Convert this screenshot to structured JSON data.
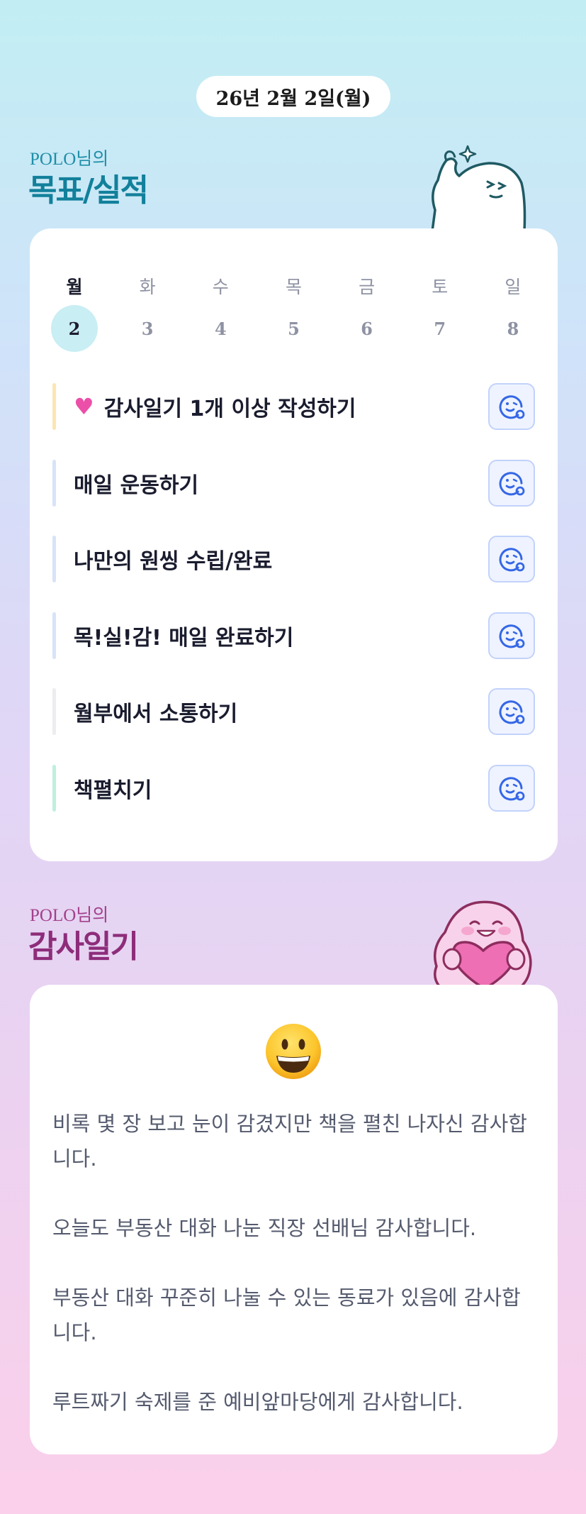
{
  "header": {
    "date": "26년 2월 2일(월)"
  },
  "goals_section": {
    "owner": "POLO님의",
    "title": "목표/실적"
  },
  "week": {
    "days": [
      "월",
      "화",
      "수",
      "목",
      "금",
      "토",
      "일"
    ],
    "dates": [
      "2",
      "3",
      "4",
      "5",
      "6",
      "7",
      "8"
    ],
    "active_index": 0
  },
  "goals": [
    {
      "label": "감사일기 1개 이상 작성하기",
      "icon": "heart-icon",
      "bar_color": "#fde5b3"
    },
    {
      "label": "매일 운동하기",
      "bar_color": "#d8e3f7"
    },
    {
      "label": "나만의 원씽 수립/완료",
      "bar_color": "#d8e3f7"
    },
    {
      "label": "목!실!감! 매일 완료하기",
      "bar_color": "#d8e3f7"
    },
    {
      "label": "월부에서 소통하기",
      "bar_color": "#ececf1"
    },
    {
      "label": "책펼치기",
      "bar_color": "#bff0dd"
    }
  ],
  "thanks_section": {
    "owner": "POLO님의",
    "title": "감사일기"
  },
  "thanks": {
    "emoji": "smiley-face-icon",
    "entries": [
      "비록 몇 장 보고 눈이 감겼지만 책을 펼친 나자신 감사합니다.",
      "오늘도 부동산 대화 나눈 직장 선배님 감사합니다.",
      "부동산 대화 꾸준히 나눌 수 있는 동료가 있음에 감사합니다.",
      "루트짜기 숙제를 준 예비앞마당에게 감사합니다."
    ]
  },
  "colors": {
    "goal_title": "#12809b",
    "thanks_title": "#8d2d7a",
    "react_button_bg": "#eef3ff",
    "react_icon": "#3567e6",
    "active_day_bg": "#c9eef4"
  }
}
